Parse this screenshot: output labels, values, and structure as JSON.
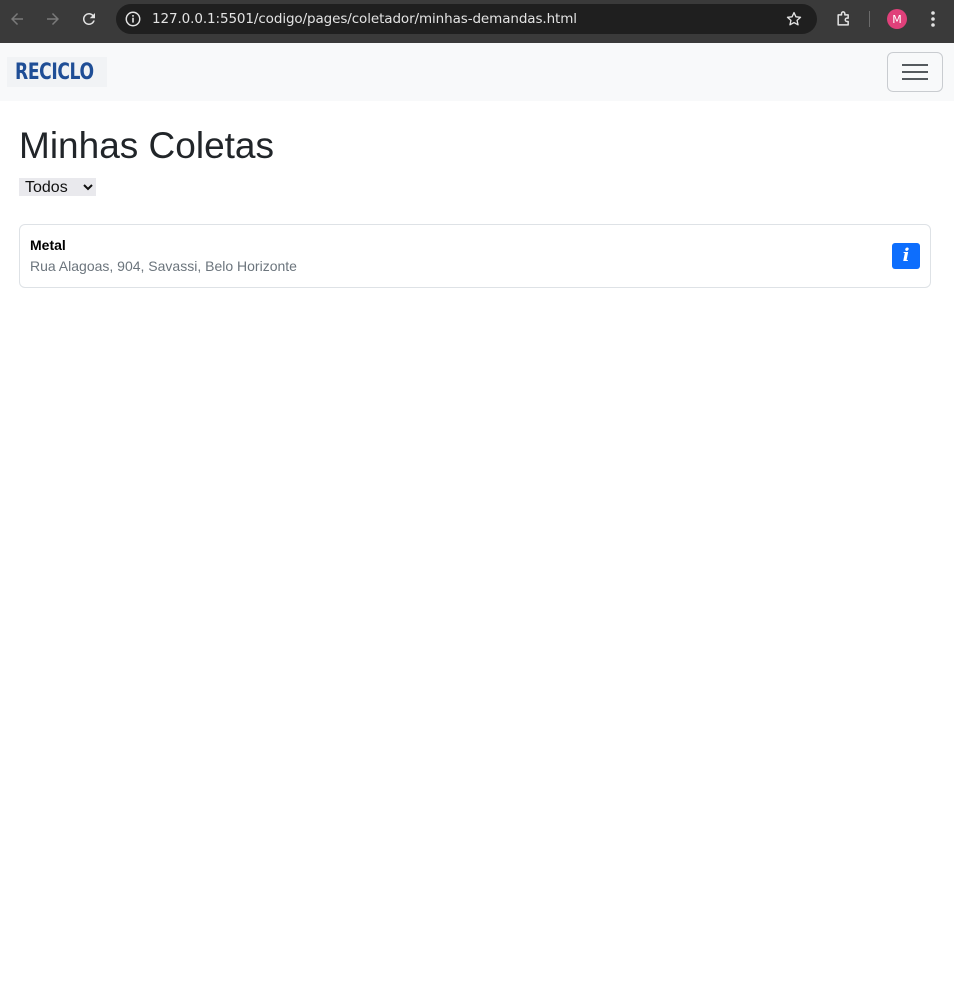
{
  "browser": {
    "url": "127.0.0.1:5501/codigo/pages/coletador/minhas-demandas.html",
    "profile_initial": "M",
    "icons": [
      "back-arrow-icon",
      "forward-arrow-icon",
      "reload-icon",
      "site-info-icon",
      "bookmark-star-icon",
      "extensions-puzzle-icon",
      "kebab-menu-icon"
    ]
  },
  "navbar": {
    "logo_text": "RECICLO",
    "toggler_icon": "hamburger-icon"
  },
  "main": {
    "title": "Minhas Coletas",
    "filter": {
      "selected": "Todos"
    },
    "cards": [
      {
        "title": "Metal",
        "address": "Rua Alagoas, 904, Savassi, Belo Horizonte",
        "action_icon": "info-icon",
        "action_glyph": "i"
      }
    ]
  },
  "colors": {
    "brand": "#1f4e96",
    "primary": "#0d6efd",
    "navbar_bg": "#f8f9fa",
    "chrome_bg": "#3a3a3a",
    "muted": "#6c757d"
  }
}
